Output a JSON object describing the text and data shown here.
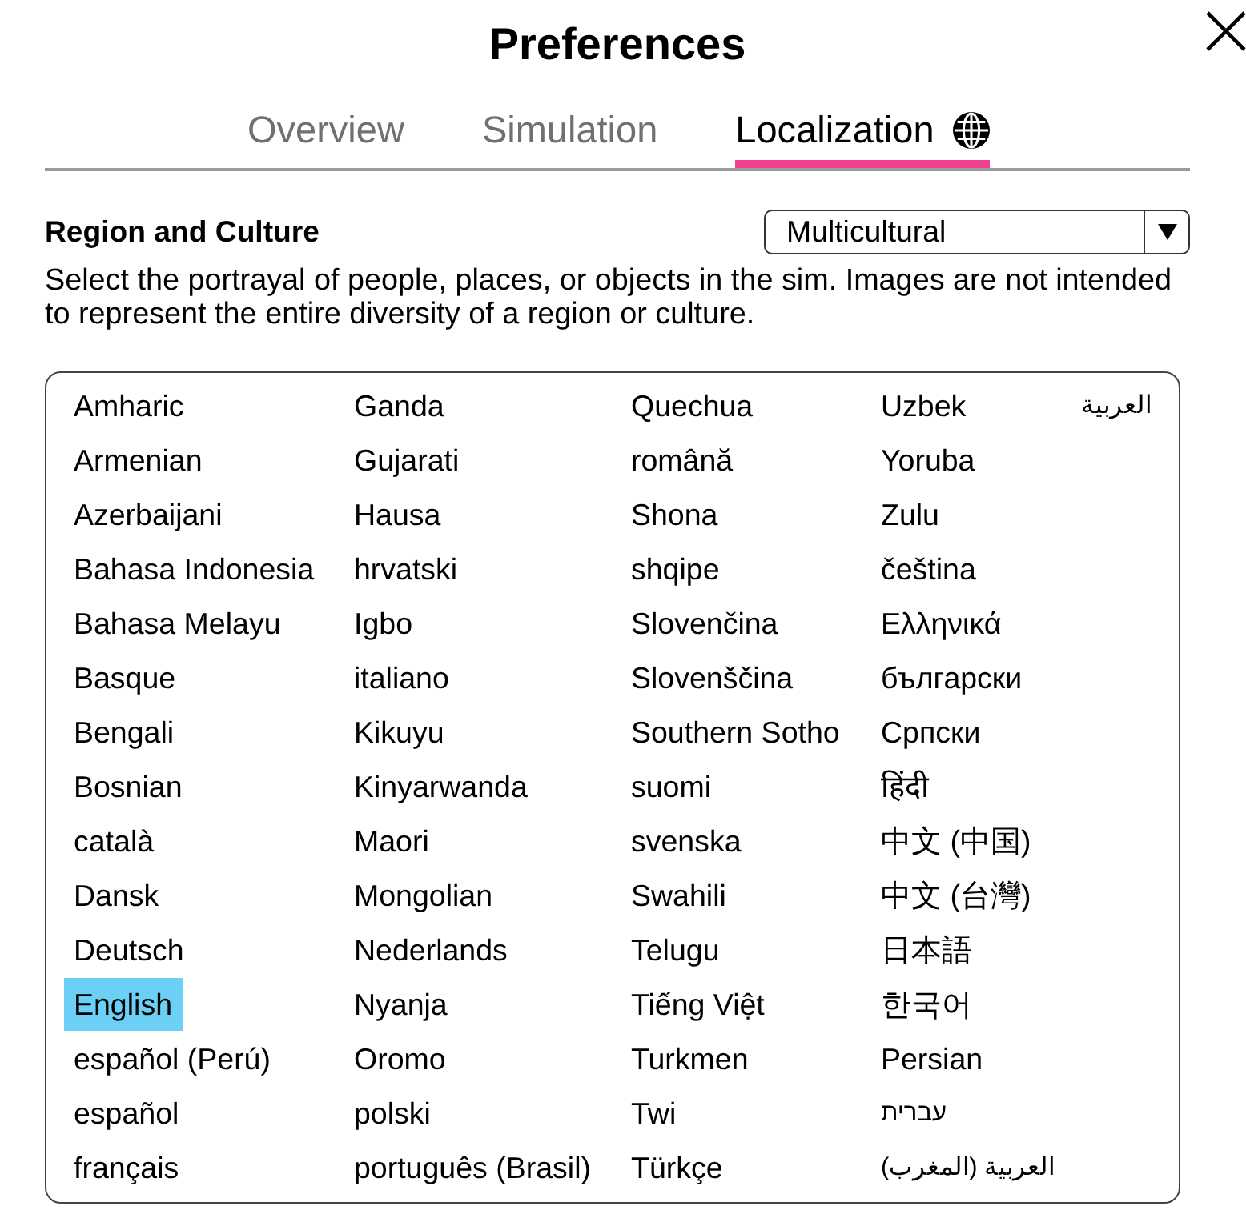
{
  "window": {
    "title": "Preferences"
  },
  "tabs": [
    {
      "label": "Overview",
      "selected": false,
      "icon": false
    },
    {
      "label": "Simulation",
      "selected": false,
      "icon": false
    },
    {
      "label": "Localization",
      "selected": true,
      "icon": true
    }
  ],
  "region_and_culture": {
    "label": "Region and Culture",
    "value": "Multicultural"
  },
  "description": "Select the portrayal of people, places, or objects in the sim. Images are not intended to represent the entire diversity of a region or culture.",
  "languages": [
    {
      "label": "Amharic",
      "selected": false
    },
    {
      "label": "Armenian",
      "selected": false
    },
    {
      "label": "Azerbaijani",
      "selected": false
    },
    {
      "label": "Bahasa Indonesia",
      "selected": false
    },
    {
      "label": "Bahasa Melayu",
      "selected": false
    },
    {
      "label": "Basque",
      "selected": false
    },
    {
      "label": "Bengali",
      "selected": false
    },
    {
      "label": "Bosnian",
      "selected": false
    },
    {
      "label": "català",
      "selected": false
    },
    {
      "label": "Dansk",
      "selected": false
    },
    {
      "label": "Deutsch",
      "selected": false
    },
    {
      "label": "English",
      "selected": true
    },
    {
      "label": "español (Perú)",
      "selected": false
    },
    {
      "label": "español",
      "selected": false
    },
    {
      "label": "français",
      "selected": false
    },
    {
      "label": "Ganda",
      "selected": false
    },
    {
      "label": "Gujarati",
      "selected": false
    },
    {
      "label": "Hausa",
      "selected": false
    },
    {
      "label": "hrvatski",
      "selected": false
    },
    {
      "label": "Igbo",
      "selected": false
    },
    {
      "label": "italiano",
      "selected": false
    },
    {
      "label": "Kikuyu",
      "selected": false
    },
    {
      "label": "Kinyarwanda",
      "selected": false
    },
    {
      "label": "Maori",
      "selected": false
    },
    {
      "label": "Mongolian",
      "selected": false
    },
    {
      "label": "Nederlands",
      "selected": false
    },
    {
      "label": "Nyanja",
      "selected": false
    },
    {
      "label": "Oromo",
      "selected": false
    },
    {
      "label": "polski",
      "selected": false
    },
    {
      "label": "português (Brasil)",
      "selected": false
    },
    {
      "label": "Quechua",
      "selected": false
    },
    {
      "label": "română",
      "selected": false
    },
    {
      "label": "Shona",
      "selected": false
    },
    {
      "label": "shqipe",
      "selected": false
    },
    {
      "label": "Slovenčina",
      "selected": false
    },
    {
      "label": "Slovenščina",
      "selected": false
    },
    {
      "label": "Southern Sotho",
      "selected": false
    },
    {
      "label": "suomi",
      "selected": false
    },
    {
      "label": "svenska",
      "selected": false
    },
    {
      "label": "Swahili",
      "selected": false
    },
    {
      "label": "Telugu",
      "selected": false
    },
    {
      "label": "Tiếng Việt",
      "selected": false
    },
    {
      "label": "Turkmen",
      "selected": false
    },
    {
      "label": "Twi",
      "selected": false
    },
    {
      "label": "Türkçe",
      "selected": false
    },
    {
      "label": "Uzbek",
      "selected": false
    },
    {
      "label": "Yoruba",
      "selected": false
    },
    {
      "label": "Zulu",
      "selected": false
    },
    {
      "label": "čeština",
      "selected": false
    },
    {
      "label": "Ελληνικά",
      "selected": false
    },
    {
      "label": "български",
      "selected": false
    },
    {
      "label": "Српски",
      "selected": false
    },
    {
      "label": "हिंदी",
      "selected": false
    },
    {
      "label": "中文 (中国)",
      "selected": false
    },
    {
      "label": "中文 (台灣)",
      "selected": false
    },
    {
      "label": "日本語",
      "selected": false
    },
    {
      "label": "한국어",
      "selected": false
    },
    {
      "label": "Persian",
      "selected": false
    },
    {
      "label": "עברית",
      "selected": false
    },
    {
      "label": "العربية (المغرب)",
      "selected": false
    },
    {
      "label": "العربية",
      "selected": false
    }
  ]
}
